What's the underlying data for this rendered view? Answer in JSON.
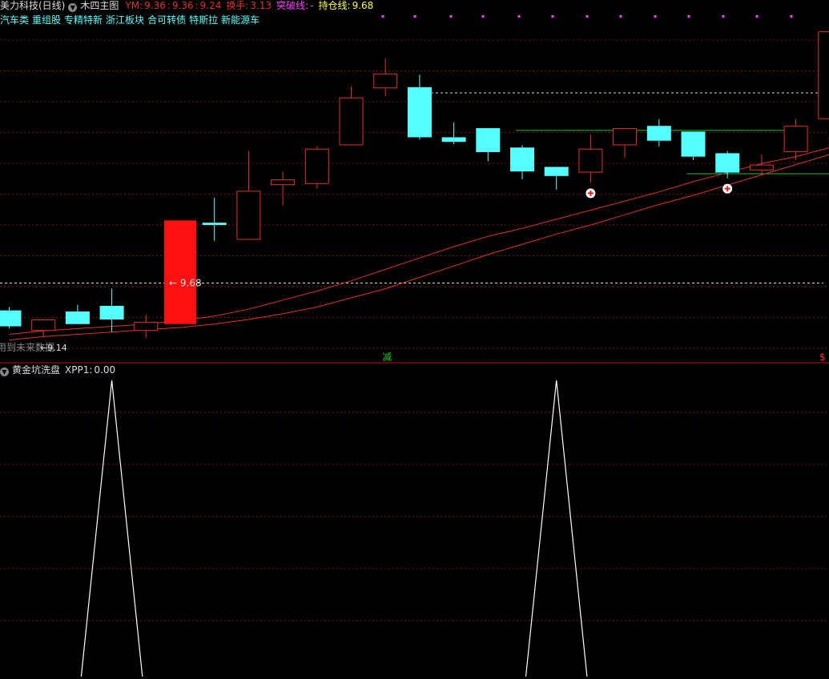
{
  "header": {
    "stock_name": "美力科技(日线)",
    "indicator_name": "木四主图",
    "ym_label": "YM:",
    "ym_values": [
      "9.36",
      "9.36",
      "9.24"
    ],
    "turnover_label": "换手:",
    "turnover_value": "3.13",
    "breakout_label": "突破线:",
    "breakout_value": "-",
    "hold_label": "持仓线:",
    "hold_value": "9.68"
  },
  "concepts": [
    "汽车类",
    "重组股",
    "专精特新",
    "浙江板块",
    "合可转债",
    "特斯拉",
    "新能源车"
  ],
  "annotations": {
    "ref_line_label": "9.68",
    "future_data_text": "用到未来数据",
    "low_value": "9.14",
    "green_marker": "减",
    "right_marker": "$"
  },
  "sub_panel": {
    "title": "黄金坑洗盘",
    "xpp_label": "XPP1:",
    "xpp_value": "0.00"
  },
  "colors": {
    "up": "#e03030",
    "down": "#54ffff",
    "ma": "#e03030",
    "green": "#22c522",
    "grid": "#7a1515",
    "magenta": "#ff40ff",
    "yellow": "#ffff40",
    "white": "#ffffff"
  },
  "chart_data": {
    "type": "candlestick",
    "candles": [
      {
        "o": 9.44,
        "h": 9.47,
        "l": 9.28,
        "c": 9.3
      },
      {
        "o": 9.26,
        "h": 9.36,
        "l": 9.21,
        "c": 9.36
      },
      {
        "o": 9.43,
        "h": 9.49,
        "l": 9.32,
        "c": 9.32
      },
      {
        "o": 9.48,
        "h": 9.63,
        "l": 9.25,
        "c": 9.36
      },
      {
        "o": 9.26,
        "h": 9.4,
        "l": 9.2,
        "c": 9.34
      },
      {
        "o": 9.32,
        "h": 10.23,
        "l": 9.32,
        "c": 10.23,
        "limit_up": true
      },
      {
        "o": 10.21,
        "h": 10.43,
        "l": 10.05,
        "c": 10.19
      },
      {
        "o": 10.06,
        "h": 10.84,
        "l": 10.06,
        "c": 10.49
      },
      {
        "o": 10.54,
        "h": 10.66,
        "l": 10.36,
        "c": 10.59
      },
      {
        "o": 10.55,
        "h": 10.88,
        "l": 10.51,
        "c": 10.86
      },
      {
        "o": 10.89,
        "h": 11.41,
        "l": 10.89,
        "c": 11.31
      },
      {
        "o": 11.39,
        "h": 11.65,
        "l": 11.32,
        "c": 11.52
      },
      {
        "o": 11.4,
        "h": 11.51,
        "l": 10.94,
        "c": 10.96
      },
      {
        "o": 10.96,
        "h": 11.09,
        "l": 10.9,
        "c": 10.92
      },
      {
        "o": 11.04,
        "h": 11.04,
        "l": 10.75,
        "c": 10.83
      },
      {
        "o": 10.87,
        "h": 10.89,
        "l": 10.59,
        "c": 10.66
      },
      {
        "o": 10.7,
        "h": 10.7,
        "l": 10.5,
        "c": 10.62
      },
      {
        "o": 10.65,
        "h": 10.98,
        "l": 10.56,
        "c": 10.86
      },
      {
        "o": 10.89,
        "h": 11.04,
        "l": 10.78,
        "c": 11.04
      },
      {
        "o": 11.06,
        "h": 11.12,
        "l": 10.88,
        "c": 10.93
      },
      {
        "o": 11.01,
        "h": 11.01,
        "l": 10.76,
        "c": 10.79
      },
      {
        "o": 10.82,
        "h": 10.84,
        "l": 10.6,
        "c": 10.65
      },
      {
        "o": 10.67,
        "h": 10.81,
        "l": 10.64,
        "c": 10.72
      },
      {
        "o": 10.83,
        "h": 11.12,
        "l": 10.76,
        "c": 11.06
      },
      {
        "o": 11.12,
        "h": 12.0,
        "l": 11.1,
        "c": 11.89
      }
    ],
    "ma_lines": [
      [
        9.23,
        9.26,
        9.28,
        9.3,
        9.32,
        9.35,
        9.39,
        9.45,
        9.53,
        9.61,
        9.7,
        9.8,
        9.9,
        10.0,
        10.09,
        10.16,
        10.24,
        10.32,
        10.4,
        10.48,
        10.57,
        10.65,
        10.73,
        10.79,
        10.87
      ],
      [
        9.18,
        9.21,
        9.23,
        9.25,
        9.27,
        9.29,
        9.32,
        9.36,
        9.41,
        9.47,
        9.55,
        9.63,
        9.73,
        9.83,
        9.93,
        10.02,
        10.11,
        10.19,
        10.28,
        10.37,
        10.45,
        10.54,
        10.63,
        10.72,
        10.81
      ]
    ],
    "price_range": [
      9.1,
      12.06
    ],
    "ref_price": 9.68,
    "hold_price": 11.35,
    "green_lines": [
      {
        "from": 15,
        "to": 23,
        "price": 11.02
      },
      {
        "from": 20,
        "to": 24,
        "price": 10.64
      }
    ],
    "buy_markers": [
      17,
      21
    ],
    "sub_indicator": {
      "range": [
        0,
        1
      ],
      "peaks": [
        {
          "center": 3,
          "value": 1
        },
        {
          "center": 16,
          "value": 1
        }
      ],
      "base_half_width": 0.9
    }
  }
}
